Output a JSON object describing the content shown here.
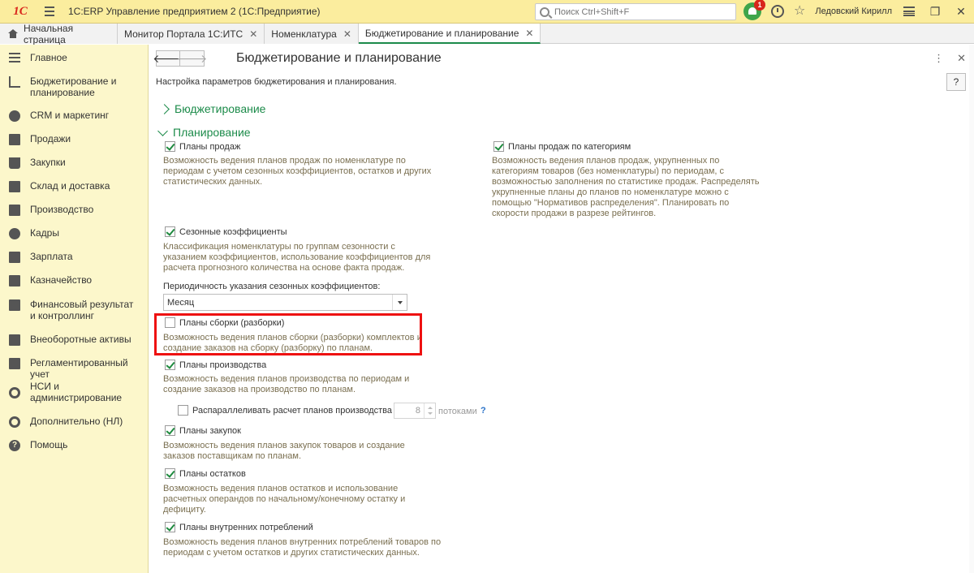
{
  "titlebar": {
    "logo": "1С",
    "app_title": "1С:ERP Управление предприятием 2  (1С:Предприятие)",
    "search_placeholder": "Поиск Ctrl+Shift+F",
    "notif_count": "1",
    "user": "Ледовский Кирилл"
  },
  "tabs": [
    {
      "label": "Начальная страница"
    },
    {
      "label": "Монитор Портала 1С:ИТС"
    },
    {
      "label": "Номенклатура"
    },
    {
      "label": "Бюджетирование и планирование"
    }
  ],
  "sidebar": {
    "items": [
      {
        "label": "Главное"
      },
      {
        "label": "Бюджетирование и планирование"
      },
      {
        "label": "CRM и маркетинг"
      },
      {
        "label": "Продажи"
      },
      {
        "label": "Закупки"
      },
      {
        "label": "Склад и доставка"
      },
      {
        "label": "Производство"
      },
      {
        "label": "Кадры"
      },
      {
        "label": "Зарплата"
      },
      {
        "label": "Казначейство"
      },
      {
        "label": "Финансовый результат и контроллинг"
      },
      {
        "label": "Внеоборотные активы"
      },
      {
        "label": "Регламентированный учет"
      },
      {
        "label": "НСИ и администрирование"
      },
      {
        "label": "Дополнительно (НЛ)"
      },
      {
        "label": "Помощь"
      }
    ]
  },
  "main": {
    "title": "Бюджетирование и планирование",
    "subtitle": "Настройка параметров бюджетирования и планирования.",
    "help": "?",
    "group_budget": "Бюджетирование",
    "group_planning": "Планирование",
    "options": {
      "sales_plans": {
        "label": "Планы продаж",
        "checked": true,
        "desc": [
          "Возможность ведения планов продаж по номенклатуре по",
          "периодам с учетом сезонных коэффициентов, остатков и других",
          "статистических данных."
        ]
      },
      "sales_by_cat": {
        "label": "Планы продаж по категориям",
        "checked": true,
        "desc": [
          "Возможность ведения планов продаж, укрупненных по",
          "категориям товаров (без номенклатуры) по периодам, с",
          "возможностью заполнения по статистике продаж. Распределять",
          "укрупненные планы до планов по номенклатуре можно с",
          "помощью \"Нормативов распределения\". Планировать по",
          "скорости продажи в разрезе рейтингов."
        ]
      },
      "seasonal": {
        "label": "Сезонные коэффициенты",
        "checked": true,
        "desc": [
          "Классификация номенклатуры по группам сезонности с",
          "указанием коэффициентов, использование коэффициентов для",
          "расчета прогнозного количества на основе факта продаж."
        ]
      },
      "assembly": {
        "label": "Планы сборки (разборки)",
        "checked": false,
        "desc": [
          "Возможность ведения планов сборки (разборки) комплектов и",
          "создание заказов на сборку (разборку) по планам."
        ]
      },
      "production": {
        "label": "Планы производства",
        "checked": true,
        "desc": [
          "Возможность ведения планов производства по периодам и",
          "создание заказов на производство по планам."
        ]
      },
      "parallel": {
        "label": "Распараллеливать расчет планов производства",
        "checked": false
      },
      "purchases": {
        "label": "Планы закупок",
        "checked": true,
        "desc": [
          "Возможность ведения планов закупок товаров и создание",
          "заказов поставщикам по планам."
        ]
      },
      "stocks": {
        "label": "Планы остатков",
        "checked": true,
        "desc": [
          "Возможность ведения планов остатков и использование",
          "расчетных операндов по начальному/конечному остатку и",
          "дефициту."
        ]
      },
      "internal": {
        "label": "Планы внутренних потреблений",
        "checked": true,
        "desc": [
          "Возможность ведения планов внутренних потреблений товаров по",
          "периодам с учетом остатков и других статистических данных."
        ]
      }
    },
    "periodicity_label": "Периодичность указания сезонных коэффициентов:",
    "periodicity_value": "Месяц",
    "threads_value": "8",
    "threads_unit": "потоками",
    "threads_help": "?"
  }
}
